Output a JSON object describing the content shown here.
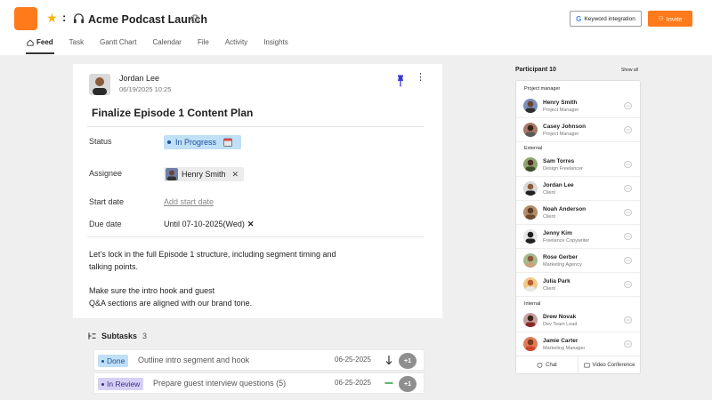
{
  "header": {
    "project_title": "Acme Podcast Launch",
    "keyword_button": "Keyword integration",
    "invite_button": "Invite",
    "colors": {
      "accent": "#ff7a1a"
    }
  },
  "tabs": [
    {
      "label": "Feed",
      "active": true
    },
    {
      "label": "Task"
    },
    {
      "label": "Gantt Chart"
    },
    {
      "label": "Calendar"
    },
    {
      "label": "File"
    },
    {
      "label": "Activity"
    },
    {
      "label": "Insights"
    }
  ],
  "post": {
    "author": "Jordan Lee",
    "timestamp": "06/19/2025 10:25",
    "title": "Finalize Episode 1 Content Plan",
    "fields": {
      "status_label": "Status",
      "status_value": "In Progress",
      "assignee_label": "Assignee",
      "assignee_value": "Henry Smith",
      "start_label": "Start date",
      "start_placeholder": "Add start date",
      "due_label": "Due date",
      "due_value": "Until 07-10-2025(Wed)"
    },
    "description": {
      "p1_line1": "Let’s lock in the full Episode 1 structure, including segment timing and",
      "p1_line2": "talking points.",
      "p2_line1": "Make sure the intro hook and guest",
      "p2_line2": "Q&A sections are aligned with our brand tone."
    }
  },
  "subtasks": {
    "label": "Subtasks",
    "count": "3",
    "items": [
      {
        "status": "Done",
        "text": "Outline intro segment and hook",
        "date": "06-25-2025",
        "extra": "+1"
      },
      {
        "status": "In Review",
        "text": "Prepare guest interview questions  (5)",
        "date": "06-25-2025",
        "extra": "+1"
      }
    ]
  },
  "participants": {
    "header": "Participant 10",
    "show_all": "Show all",
    "groups": {
      "pm": "Project manager",
      "external": "External",
      "internal": "Internal"
    },
    "people": [
      {
        "name": "Henry Smith",
        "role": "Project Manager"
      },
      {
        "name": "Casey Johnson",
        "role": "Project Manager"
      },
      {
        "name": "Sam Torres",
        "role": "Design Freelancer"
      },
      {
        "name": "Jordan Lee",
        "role": "Client"
      },
      {
        "name": "Noah Anderson",
        "role": "Client"
      },
      {
        "name": "Jenny Kim",
        "role": "Freelance Copywriter"
      },
      {
        "name": "Rose Gerber",
        "role": "Marketing Agency"
      },
      {
        "name": "Julia Park",
        "role": "Client"
      },
      {
        "name": "Drew Novak",
        "role": "Dev Team Lead"
      },
      {
        "name": "Jamie Carter",
        "role": "Marketing Manager"
      }
    ],
    "footer": {
      "chat": "Chat",
      "video": "Video Conference"
    }
  }
}
